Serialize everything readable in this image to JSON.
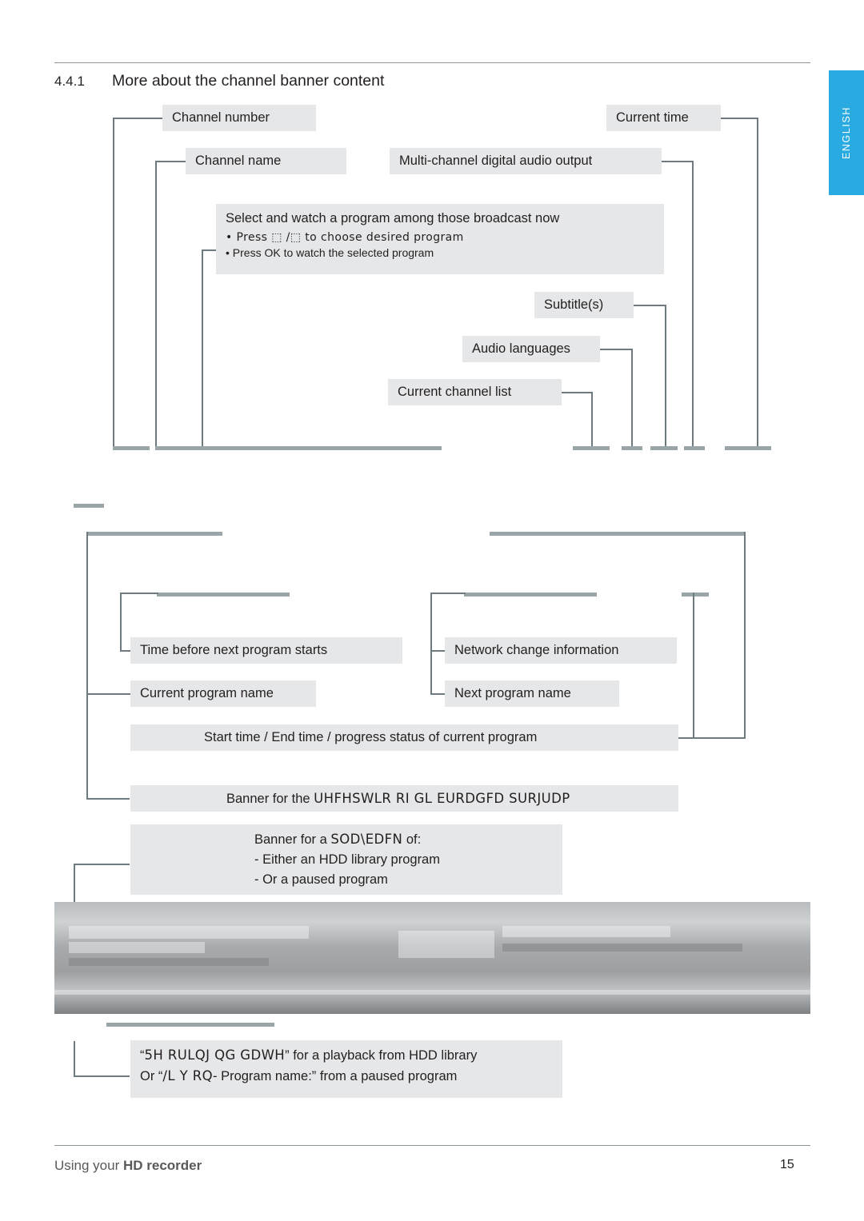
{
  "page": {
    "section_number": "4.4.1",
    "section_title": "More about the channel banner content",
    "footer_left_prefix": "Using your ",
    "footer_left_bold": "HD recorder",
    "page_number": "15",
    "side_tab_label": "ENGLISH"
  },
  "callouts": {
    "channel_number": "Channel number",
    "current_time": "Current time",
    "channel_name": "Channel name",
    "multi_channel_audio": "Multi-channel digital audio output",
    "select_watch_title": "Select and watch a program among those broadcast now",
    "select_watch_line1": "• Press ⬚ /⬚  to choose desired program",
    "select_watch_line2": "• Press OK to watch the selected program",
    "subtitles": "Subtitle(s)",
    "audio_languages": "Audio languages",
    "current_channel_list": "Current channel list",
    "time_before_next": "Time before next program starts",
    "network_change": "Network change information",
    "current_program_name": "Current program name",
    "next_program_name": "Next program name",
    "start_end_progress": "Start time / End time / progress status of current program",
    "banner_recep_prefix": "Banner for the ",
    "banner_recep_garbled": "UHFHSWLR RI GL  EURDGFD  SURJUDP",
    "banner_playback_prefix": "Banner for a ",
    "banner_playback_garbled": "SOD\\EDFN",
    "banner_playback_suffix": " of:",
    "banner_playback_line2": "- Either an HDD library program",
    "banner_playback_line3": "- Or a paused program",
    "bottom_line1_open": "“",
    "bottom_line1_garbled": "5H RULQJ QG GDWH",
    "bottom_line1_rest": "” for a playback from HDD library",
    "bottom_line2_open": "Or “",
    "bottom_line2_garbled": "/L Y RQ",
    "bottom_line2_rest": "- Program name:” from a paused program"
  }
}
